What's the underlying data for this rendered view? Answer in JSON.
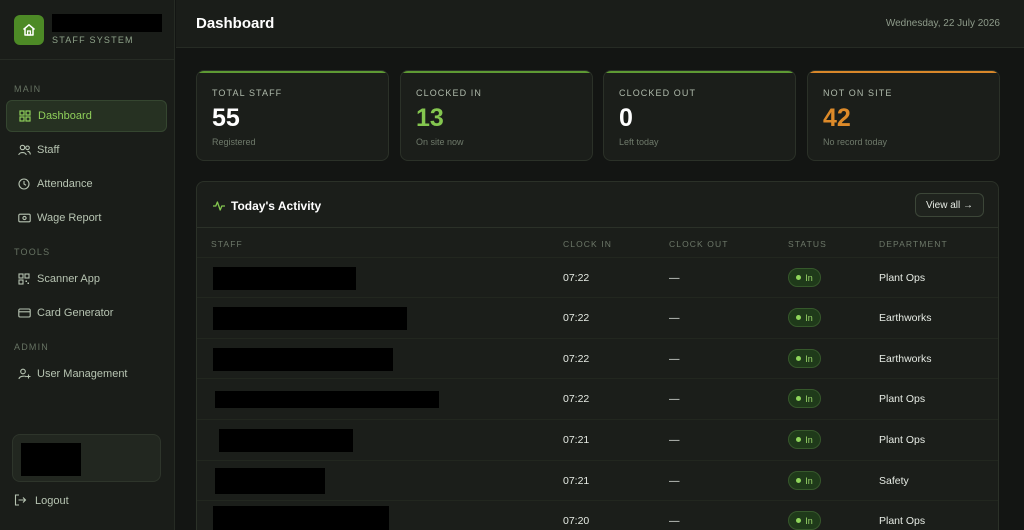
{
  "brand": {
    "subtitle": "STAFF SYSTEM"
  },
  "sidebar": {
    "sections": [
      {
        "label": "MAIN",
        "items": [
          {
            "label": "Dashboard",
            "icon": "grid-icon",
            "active": true
          },
          {
            "label": "Staff",
            "icon": "users-icon"
          },
          {
            "label": "Attendance",
            "icon": "clock-icon"
          },
          {
            "label": "Wage Report",
            "icon": "money-icon"
          }
        ]
      },
      {
        "label": "TOOLS",
        "items": [
          {
            "label": "Scanner App",
            "icon": "qr-icon"
          },
          {
            "label": "Card Generator",
            "icon": "card-icon"
          }
        ]
      },
      {
        "label": "ADMIN",
        "items": [
          {
            "label": "User Management",
            "icon": "user-gear-icon"
          }
        ]
      }
    ],
    "logout_label": "Logout"
  },
  "header": {
    "title": "Dashboard",
    "date": "Wednesday, 22 July 2026"
  },
  "stats": [
    {
      "label": "TOTAL STAFF",
      "value": "55",
      "sub": "Registered"
    },
    {
      "label": "CLOCKED IN",
      "value": "13",
      "sub": "On site now"
    },
    {
      "label": "CLOCKED OUT",
      "value": "0",
      "sub": "Left today"
    },
    {
      "label": "NOT ON SITE",
      "value": "42",
      "sub": "No record today"
    }
  ],
  "activity": {
    "title": "Today's Activity",
    "view_all": "View all →",
    "columns": [
      "STAFF",
      "CLOCK IN",
      "CLOCK OUT",
      "STATUS",
      "DEPARTMENT"
    ],
    "rows": [
      {
        "clock_in": "07:22",
        "clock_out": "—",
        "status": "In",
        "department": "Plant Ops"
      },
      {
        "clock_in": "07:22",
        "clock_out": "—",
        "status": "In",
        "department": "Earthworks"
      },
      {
        "clock_in": "07:22",
        "clock_out": "—",
        "status": "In",
        "department": "Earthworks"
      },
      {
        "clock_in": "07:22",
        "clock_out": "—",
        "status": "In",
        "department": "Plant Ops"
      },
      {
        "clock_in": "07:21",
        "clock_out": "—",
        "status": "In",
        "department": "Plant Ops"
      },
      {
        "clock_in": "07:21",
        "clock_out": "—",
        "status": "In",
        "department": "Safety"
      },
      {
        "clock_in": "07:20",
        "clock_out": "—",
        "status": "In",
        "department": "Plant Ops"
      }
    ]
  },
  "colors": {
    "accent": "#84c64f",
    "warning": "#dd8a29",
    "background": "#131513",
    "panel": "#1b1e1a"
  }
}
